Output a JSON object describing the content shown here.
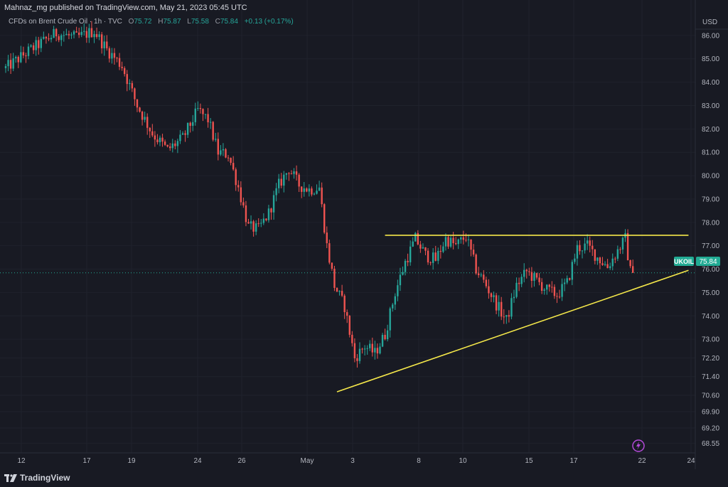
{
  "header": {
    "published": "Mahnaz_mg published on TradingView.com, May 21, 2023 05:45 UTC"
  },
  "legend": {
    "symbol": "CFDs on Brent Crude Oil · 1h · TVC",
    "o_label": "O",
    "o_value": "75.72",
    "h_label": "H",
    "h_value": "75.87",
    "l_label": "L",
    "l_value": "75.58",
    "c_label": "C",
    "c_value": "75.84",
    "change": "+0.13 (+0.17%)"
  },
  "footer": {
    "brand": "TradingView"
  },
  "colors": {
    "background": "#181a23",
    "up": "#26a69a",
    "down": "#ef5350",
    "trendline": "#f5e84a",
    "price_label": "#22ab94",
    "axis_text": "#b2b5be"
  },
  "chart_data": {
    "type": "candlestick",
    "symbol": "UKOIL",
    "currency": "USD",
    "last_price": 75.84,
    "last_label": "75.84",
    "symbol_label": "UKOIL",
    "ylim": [
      68.2,
      86.3
    ],
    "y_ticks": [
      "86.00",
      "85.00",
      "84.00",
      "83.00",
      "82.00",
      "81.00",
      "80.00",
      "79.00",
      "78.00",
      "77.00",
      "76.00",
      "75.00",
      "74.00",
      "73.00",
      "72.20",
      "71.40",
      "70.60",
      "69.90",
      "69.20",
      "68.55"
    ],
    "x_ticks": [
      "12",
      "17",
      "19",
      "24",
      "26",
      "May",
      "3",
      "8",
      "10",
      "15",
      "17",
      "22",
      "24"
    ],
    "price_path": [
      [
        0,
        84.6
      ],
      [
        10,
        85.4
      ],
      [
        20,
        86.1
      ],
      [
        28,
        85.9
      ],
      [
        35,
        86.2
      ],
      [
        40,
        85.4
      ],
      [
        46,
        84.7
      ],
      [
        52,
        83.0
      ],
      [
        58,
        81.8
      ],
      [
        64,
        81.1
      ],
      [
        70,
        81.6
      ],
      [
        76,
        82.8
      ],
      [
        80,
        82.4
      ],
      [
        84,
        81.0
      ],
      [
        88,
        80.9
      ],
      [
        92,
        79.5
      ],
      [
        96,
        77.8
      ],
      [
        100,
        77.7
      ],
      [
        104,
        78.4
      ],
      [
        108,
        79.6
      ],
      [
        112,
        80.3
      ],
      [
        116,
        79.6
      ],
      [
        120,
        79.4
      ],
      [
        124,
        79.5
      ],
      [
        127,
        77.0
      ],
      [
        130,
        75.3
      ],
      [
        134,
        74.4
      ],
      [
        138,
        72.2
      ],
      [
        142,
        72.7
      ],
      [
        146,
        72.4
      ],
      [
        150,
        73.2
      ],
      [
        154,
        75.0
      ],
      [
        158,
        76.3
      ],
      [
        162,
        77.3
      ],
      [
        166,
        76.6
      ],
      [
        170,
        76.4
      ],
      [
        174,
        77.3
      ],
      [
        178,
        77.0
      ],
      [
        182,
        77.4
      ],
      [
        186,
        76.0
      ],
      [
        190,
        75.3
      ],
      [
        194,
        74.5
      ],
      [
        198,
        73.8
      ],
      [
        202,
        75.3
      ],
      [
        206,
        75.9
      ],
      [
        210,
        75.5
      ],
      [
        214,
        75.1
      ],
      [
        218,
        74.9
      ],
      [
        222,
        75.4
      ],
      [
        226,
        76.9
      ],
      [
        230,
        77.0
      ],
      [
        234,
        76.5
      ],
      [
        238,
        76.1
      ],
      [
        242,
        76.8
      ],
      [
        245,
        77.3
      ],
      [
        247,
        75.9
      ],
      [
        248,
        75.84
      ]
    ],
    "annotations": [
      {
        "type": "horizontal-resistance",
        "price": 77.45,
        "from": 150,
        "to": 270
      },
      {
        "type": "ascending-support",
        "p1": [
          131,
          70.75
        ],
        "p2": [
          270,
          75.95
        ]
      }
    ]
  }
}
